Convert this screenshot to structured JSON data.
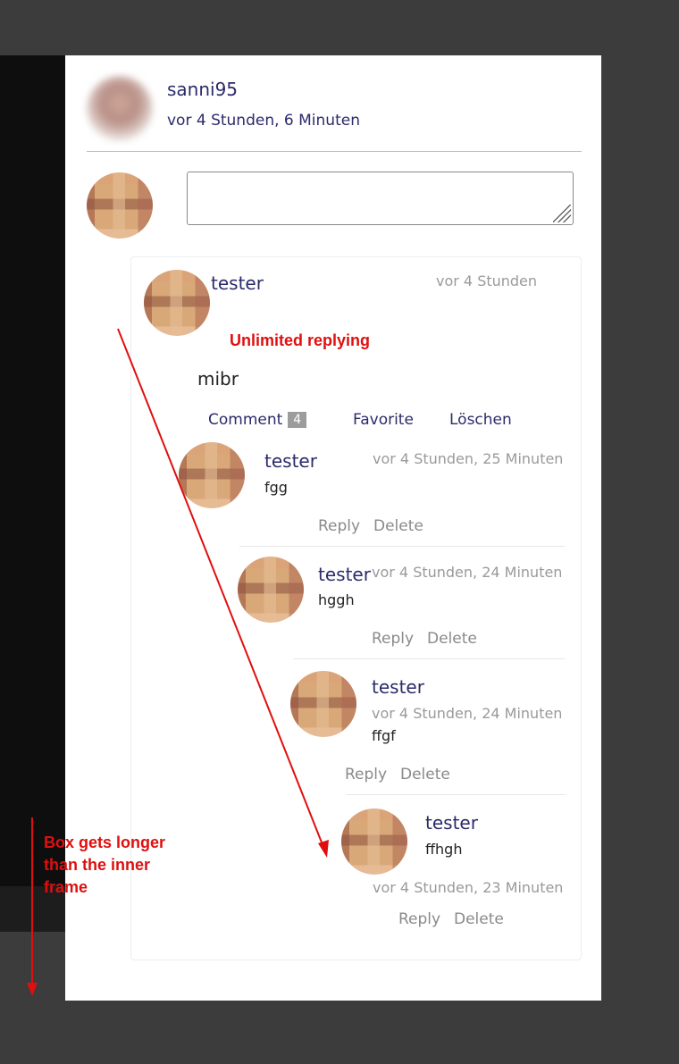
{
  "post": {
    "author": "sanni95",
    "timestamp": "vor 4 Stunden, 6 Minuten"
  },
  "top_comment": {
    "author": "tester",
    "timestamp": "vor 4 Stunden",
    "text": "mibr",
    "actions": {
      "comment_label": "Comment",
      "comment_count": "4",
      "favorite_label": "Favorite",
      "delete_label": "Löschen"
    }
  },
  "replies": [
    {
      "author": "tester",
      "timestamp": "vor 4 Stunden, 25 Minuten",
      "text": "fgg",
      "reply_label": "Reply",
      "delete_label": "Delete"
    },
    {
      "author": "tester",
      "timestamp": "vor 4 Stunden, 24 Minuten",
      "text": "hggh",
      "reply_label": "Reply",
      "delete_label": "Delete"
    },
    {
      "author": "tester",
      "timestamp": "vor 4 Stunden, 24 Minuten",
      "text": "ffgf",
      "reply_label": "Reply",
      "delete_label": "Delete"
    },
    {
      "author": "tester",
      "timestamp": "vor 4 Stunden, 23 Minuten",
      "text": "ffhgh",
      "reply_label": "Reply",
      "delete_label": "Delete"
    }
  ],
  "annotations": {
    "unlimited": "Unlimited replying",
    "box_line1": "Box gets longer",
    "box_line2": "than the inner",
    "box_line3": "frame",
    "color": "#e00f0f"
  },
  "colors": {
    "page_background": "#3c3c3c",
    "panel": "#ffffff",
    "username": "#2b2b6b",
    "muted": "#9a9a9a"
  },
  "icons": [
    "avatar-icon",
    "resize-grip-icon",
    "arrow-icon"
  ]
}
